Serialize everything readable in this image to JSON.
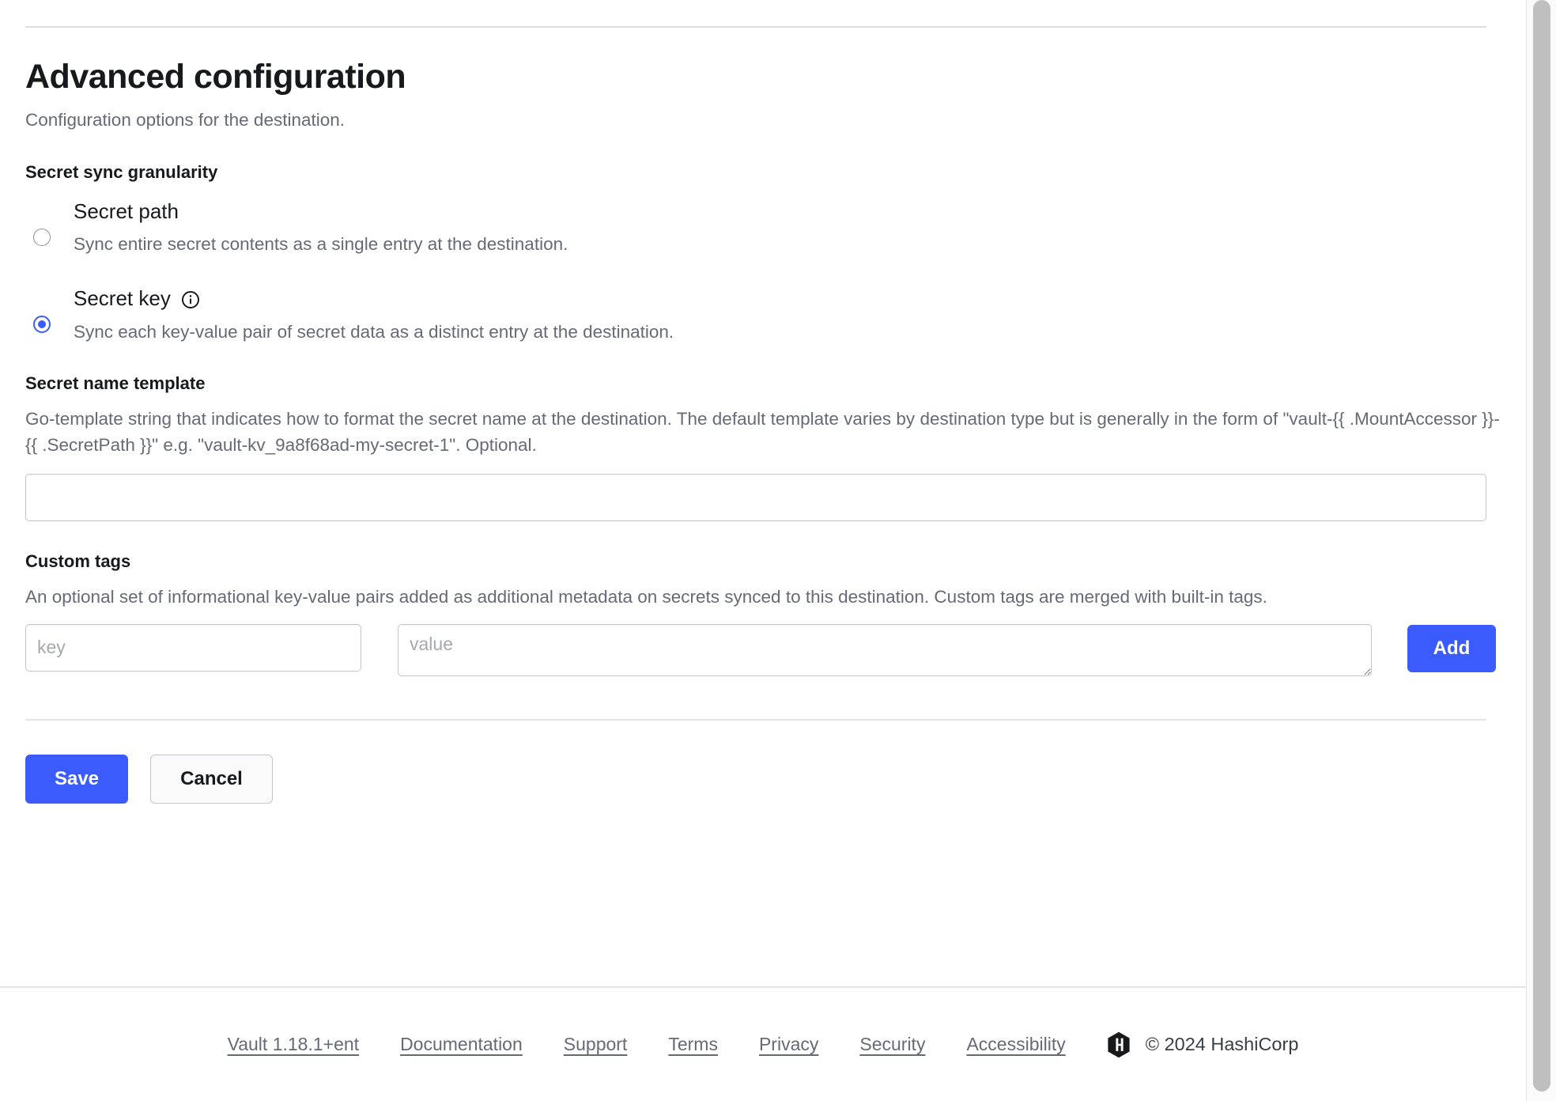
{
  "header": {
    "title": "Advanced configuration",
    "subtitle": "Configuration options for the destination."
  },
  "granularity": {
    "label": "Secret sync granularity",
    "options": [
      {
        "title": "Secret path",
        "description": "Sync entire secret contents as a single entry at the destination.",
        "selected": false,
        "has_info_icon": false,
        "icon": ""
      },
      {
        "title": "Secret key",
        "description": "Sync each key-value pair of secret data as a distinct entry at the destination.",
        "selected": true,
        "has_info_icon": true,
        "icon": "info-icon"
      }
    ]
  },
  "secret_name_template": {
    "label": "Secret name template",
    "help": "Go-template string that indicates how to format the secret name at the destination. The default template varies by destination type but is generally in the form of \"vault-{{ .MountAccessor }}-{{ .SecretPath }}\" e.g. \"vault-kv_9a8f68ad-my-secret-1\". Optional.",
    "value": "",
    "placeholder": ""
  },
  "custom_tags": {
    "label": "Custom tags",
    "help": "An optional set of informational key-value pairs added as additional metadata on secrets synced to this destination. Custom tags are merged with built-in tags.",
    "key_value": "",
    "key_placeholder": "key",
    "value_value": "",
    "value_placeholder": "value",
    "add_label": "Add"
  },
  "actions": {
    "save_label": "Save",
    "cancel_label": "Cancel"
  },
  "footer": {
    "links": [
      "Vault 1.18.1+ent",
      "Documentation",
      "Support",
      "Terms",
      "Privacy",
      "Security",
      "Accessibility"
    ],
    "logo": "hashicorp-logo-icon",
    "copyright": "© 2024 HashiCorp"
  },
  "colors": {
    "accent": "#3b5bfd",
    "text": "#17191d",
    "muted": "#656a76",
    "border": "#c2c5cd",
    "divider": "#e4e5ea"
  }
}
